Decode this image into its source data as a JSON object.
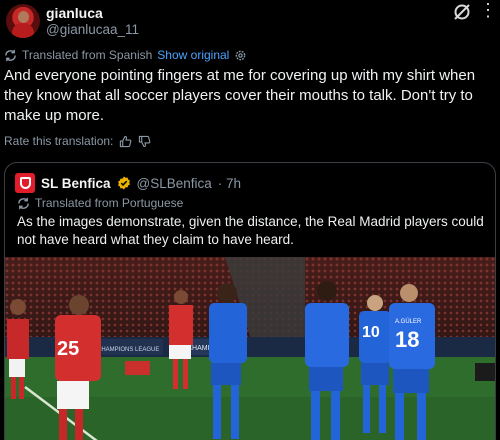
{
  "post": {
    "author_name": "gianluca",
    "author_handle": "@gianlucaa_11",
    "translated_label": "Translated from Spanish",
    "show_original": "Show original",
    "text": "And everyone pointing fingers at me for covering up with my shirt when they know that all soccer players cover their mouths to talk. Don't try to make up more.",
    "rate_label": "Rate this translation:"
  },
  "quote": {
    "author_name": "SL Benfica",
    "author_handle": "@SLBenfica",
    "time": "· 7h",
    "translated_label": "Translated from Portuguese",
    "text": "As the images demonstrate, given the distance, the Real Madrid players could not have heard what they claim to have heard.",
    "jersey_left": "25",
    "jersey_mid": "10",
    "jersey_right": "18",
    "jersey_right_name": "A.GÜLER",
    "ad_board": "CHAMPIONS LEAGUE",
    "ad_board_short": "CHAMI"
  },
  "colors": {
    "accent": "#1d9bf0",
    "benfica_red": "#e11d2b",
    "madrid_blue": "#1e5fd8",
    "pitch": "#2f6d2c"
  }
}
